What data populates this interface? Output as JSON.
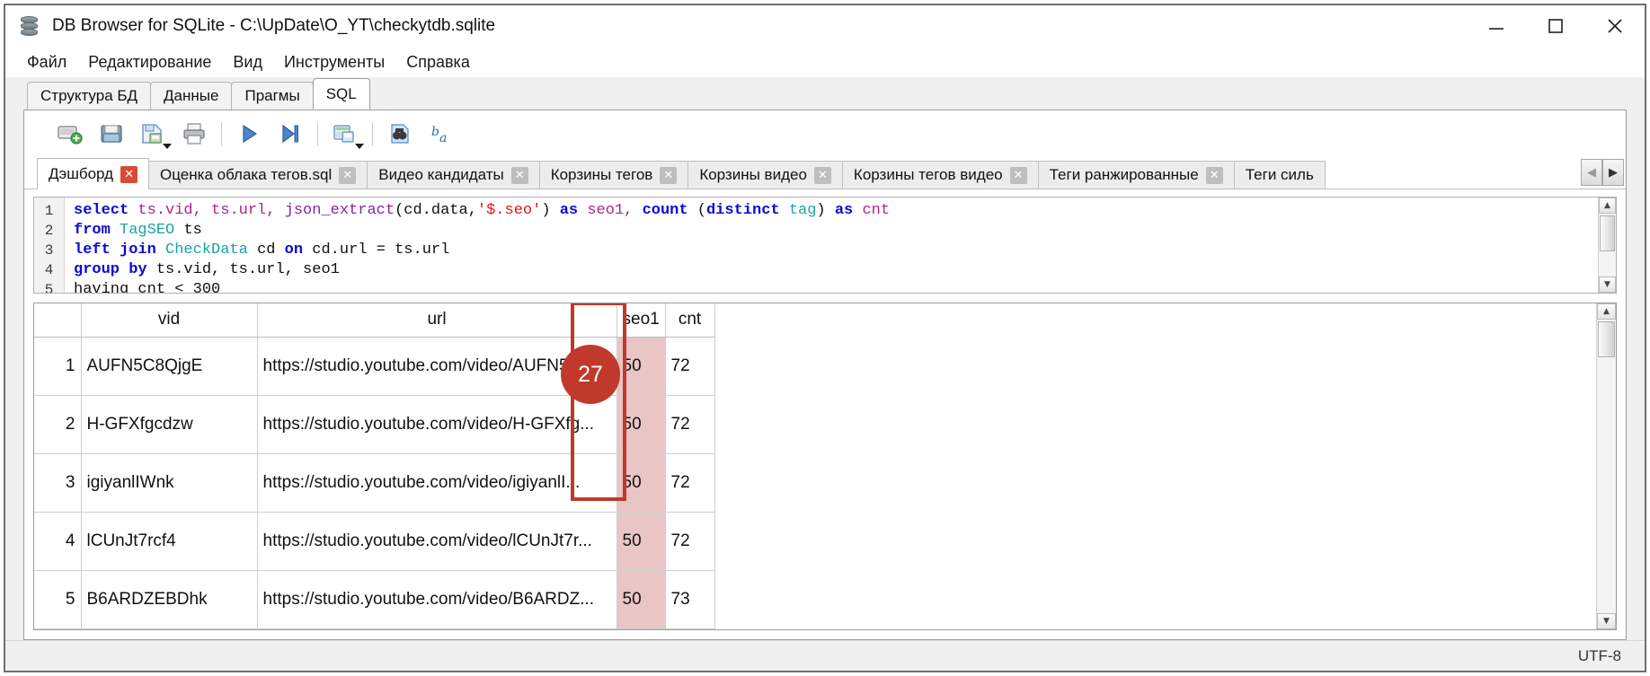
{
  "window": {
    "title": "DB Browser for SQLite - C:\\UpDate\\O_YT\\checkytdb.sqlite",
    "icon": "database-icon",
    "controls": {
      "minimize": "minimize-icon",
      "maximize": "maximize-icon",
      "close": "close-icon"
    }
  },
  "menu": {
    "items": [
      {
        "label": "Файл"
      },
      {
        "label": "Редактирование"
      },
      {
        "label": "Вид"
      },
      {
        "label": "Инструменты"
      },
      {
        "label": "Справка"
      }
    ]
  },
  "main_tabs": [
    {
      "label": "Структура БД",
      "active": false
    },
    {
      "label": "Данные",
      "active": false
    },
    {
      "label": "Прагмы",
      "active": false
    },
    {
      "label": "SQL",
      "active": true
    }
  ],
  "toolbar": {
    "buttons": [
      {
        "name": "new-tab-icon",
        "title": "Открыть вкладку"
      },
      {
        "name": "open-file-icon",
        "title": "Открыть файл SQL"
      },
      {
        "name": "save-file-icon",
        "title": "Сохранить файл SQL",
        "has_menu": true
      },
      {
        "name": "print-icon",
        "title": "Печать"
      },
      {
        "name": "execute-all-icon",
        "title": "Выполнить все"
      },
      {
        "name": "execute-line-icon",
        "title": "Выполнить текущую строку"
      },
      {
        "name": "save-results-icon",
        "title": "Сохранить результаты",
        "has_menu": true
      },
      {
        "name": "find-icon",
        "title": "Найти"
      },
      {
        "name": "format-sql-icon",
        "title": "Форматировать SQL"
      }
    ]
  },
  "sql_tabs": {
    "items": [
      {
        "label": "Дэшборд",
        "active": true,
        "close": "✕"
      },
      {
        "label": "Оценка облака тегов.sql",
        "active": false,
        "close": "✕"
      },
      {
        "label": "Видео кандидаты",
        "active": false,
        "close": "✕"
      },
      {
        "label": "Корзины тегов",
        "active": false,
        "close": "✕"
      },
      {
        "label": "Корзины видео",
        "active": false,
        "close": "✕"
      },
      {
        "label": "Корзины тегов видео",
        "active": false,
        "close": "✕"
      },
      {
        "label": "Теги ранжированные",
        "active": false,
        "close": "✕"
      },
      {
        "label": "Теги силь",
        "active": false,
        "close": "✕"
      }
    ],
    "scroll_left": "◀",
    "scroll_right": "▶"
  },
  "editor": {
    "line_numbers": [
      "1",
      "2",
      "3",
      "4",
      "5"
    ],
    "lines": [
      [
        {
          "t": "select ",
          "c": "kw"
        },
        {
          "t": "ts.vid, ts.url, ",
          "c": "col"
        },
        {
          "t": "json_extract",
          "c": "fn"
        },
        {
          "t": "(cd.data,",
          "c": "pl"
        },
        {
          "t": "'$.seo'",
          "c": "str"
        },
        {
          "t": ") ",
          "c": "pl"
        },
        {
          "t": "as ",
          "c": "kw"
        },
        {
          "t": "seo1, ",
          "c": "col"
        },
        {
          "t": "count ",
          "c": "kw"
        },
        {
          "t": "(",
          "c": "pl"
        },
        {
          "t": "distinct ",
          "c": "kw"
        },
        {
          "t": "tag",
          "c": "tbl"
        },
        {
          "t": ") ",
          "c": "pl"
        },
        {
          "t": "as ",
          "c": "kw"
        },
        {
          "t": "cnt",
          "c": "col"
        }
      ],
      [
        {
          "t": "from ",
          "c": "kw"
        },
        {
          "t": "TagSEO ",
          "c": "tbl"
        },
        {
          "t": "ts",
          "c": "pl"
        }
      ],
      [
        {
          "t": "left join ",
          "c": "kw"
        },
        {
          "t": "CheckData ",
          "c": "tbl"
        },
        {
          "t": "cd ",
          "c": "pl"
        },
        {
          "t": "on ",
          "c": "kw"
        },
        {
          "t": "cd.url = ts.url",
          "c": "pl"
        }
      ],
      [
        {
          "t": "group by ",
          "c": "kw"
        },
        {
          "t": "ts.vid, ts.url, seo1",
          "c": "pl"
        }
      ],
      [
        {
          "t": "  having cnt < 300",
          "c": "pl"
        }
      ]
    ],
    "scroll_up": "▲",
    "scroll_down": "▼"
  },
  "annotation": {
    "badge_number": "27",
    "badge_color": "#c0392b",
    "highlight_column": "seo1",
    "highlight_color": "#c0392b"
  },
  "results": {
    "columns": [
      "",
      "vid",
      "url",
      "seo1",
      "cnt"
    ],
    "rows": [
      {
        "idx": "1",
        "vid": "AUFN5C8QjgE",
        "url": "https://studio.youtube.com/video/AUFN5C...",
        "seo1": "50",
        "cnt": "72"
      },
      {
        "idx": "2",
        "vid": "H-GFXfgcdzw",
        "url": "https://studio.youtube.com/video/H-GFXfg...",
        "seo1": "50",
        "cnt": "72"
      },
      {
        "idx": "3",
        "vid": "igiyanlIWnk",
        "url": "https://studio.youtube.com/video/igiyanlI...",
        "seo1": "50",
        "cnt": "72"
      },
      {
        "idx": "4",
        "vid": "lCUnJt7rcf4",
        "url": "https://studio.youtube.com/video/lCUnJt7r...",
        "seo1": "50",
        "cnt": "72"
      },
      {
        "idx": "5",
        "vid": "B6ARDZEBDhk",
        "url": "https://studio.youtube.com/video/B6ARDZ...",
        "seo1": "50",
        "cnt": "73"
      }
    ],
    "scroll_up": "▲",
    "scroll_down": "▼"
  },
  "statusbar": {
    "encoding": "UTF-8"
  }
}
